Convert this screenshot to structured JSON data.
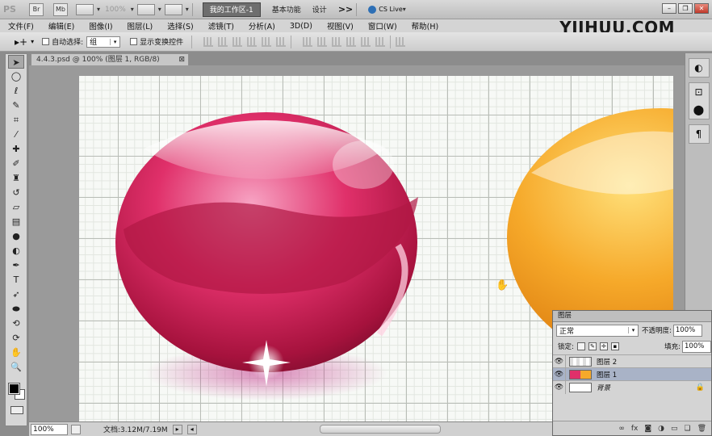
{
  "app": {
    "logo": "PS",
    "zoom": "100%",
    "workspace_active": "我的工作区-1",
    "workspace_items": [
      "基本功能",
      "设计"
    ],
    "more": ">>",
    "cs_live": "CS Live"
  },
  "menu": [
    "文件(F)",
    "编辑(E)",
    "图像(I)",
    "图层(L)",
    "选择(S)",
    "滤镜(T)",
    "分析(A)",
    "3D(D)",
    "视图(V)",
    "窗口(W)",
    "帮助(H)"
  ],
  "watermark": "YIIHUU.COM",
  "options": {
    "auto_select_label": "自动选择:",
    "auto_select_value": "组",
    "show_transform_label": "显示变换控件"
  },
  "document": {
    "tab_title": "4.4.3.psd @ 100% (图层 1, RGB/8)"
  },
  "status": {
    "zoom": "100%",
    "doc_info": "文档:3.12M/7.19M"
  },
  "layers_panel": {
    "title": "图层",
    "blend_mode": "正常",
    "opacity_label": "不透明度:",
    "opacity": "100%",
    "lock_label": "锁定:",
    "fill_label": "填充:",
    "fill": "100%",
    "layers": [
      {
        "name": "图层 2",
        "selected": false
      },
      {
        "name": "图层 1",
        "selected": true
      },
      {
        "name": "背景",
        "selected": false
      }
    ]
  },
  "colors": {
    "pink_ball": "#e0306a",
    "orange_ball": "#f6a92a",
    "selected_layer": "#a9b3c7"
  }
}
